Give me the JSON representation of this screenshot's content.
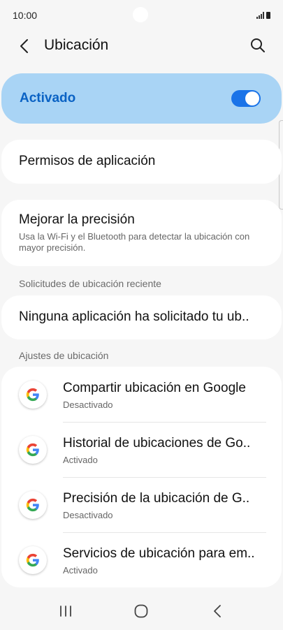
{
  "status_bar": {
    "time": "10:00"
  },
  "header": {
    "title": "Ubicación"
  },
  "master_toggle": {
    "label": "Activado",
    "state": true,
    "accent": "#1a73e8",
    "background": "#a9d4f5"
  },
  "app_permissions": {
    "label": "Permisos de aplicación"
  },
  "improve_accuracy": {
    "title": "Mejorar la precisión",
    "description": "Usa la Wi-Fi y el Bluetooth para detectar la ubicación con mayor precisión."
  },
  "recent_requests": {
    "section_title": "Solicitudes de ubicación reciente",
    "text": "Ninguna aplicación ha solicitado tu ub.."
  },
  "location_settings": {
    "section_title": "Ajustes de ubicación",
    "items": [
      {
        "title": "Compartir ubicación en Google",
        "status": "Desactivado",
        "icon": "google-icon"
      },
      {
        "title": "Historial de ubicaciones de Go..",
        "status": "Activado",
        "icon": "google-icon"
      },
      {
        "title": "Precisión de la ubicación de G..",
        "status": "Desactivado",
        "icon": "google-icon"
      },
      {
        "title": "Servicios de ubicación para em..",
        "status": "Activado",
        "icon": "google-icon"
      }
    ]
  },
  "nav_bar": {
    "buttons": [
      "recent-apps-icon",
      "home-icon",
      "back-icon"
    ]
  }
}
